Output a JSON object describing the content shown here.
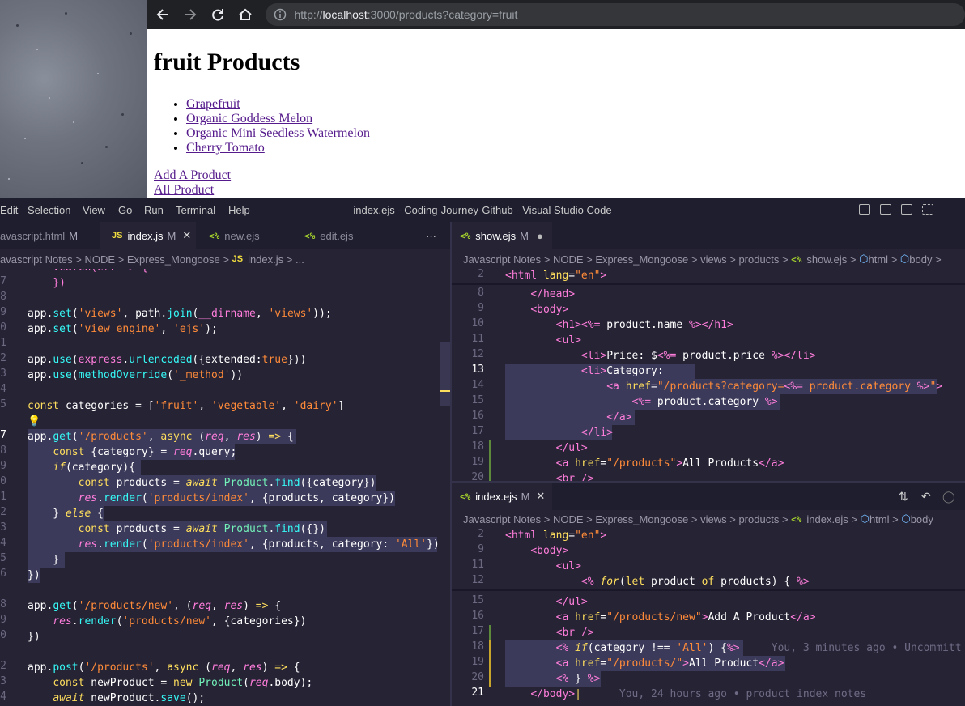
{
  "browser": {
    "url_scheme": "http://",
    "url_host": "localhost",
    "url_rest": ":3000/products?category=fruit",
    "heading": "fruit Products",
    "products": [
      "Grapefruit",
      "Organic Goddess Melon",
      "Organic Mini Seedless Watermelon",
      "Cherry Tomato"
    ],
    "add_link": "Add A Product",
    "all_link": "All Product"
  },
  "vscode": {
    "menu": [
      "Edit",
      "Selection",
      "View",
      "Go",
      "Run",
      "Terminal",
      "Help"
    ],
    "window_title": "index.ejs - Coding-Journey-Github - Visual Studio Code",
    "left_tabs": [
      {
        "label": "avascript.html",
        "badge": "M"
      },
      {
        "label": "index.js",
        "badge": "M",
        "icon": "JS"
      },
      {
        "label": "new.ejs",
        "icon": "<%"
      },
      {
        "label": "edit.ejs",
        "icon": "<%"
      }
    ],
    "left_breadcrumb": [
      "avascript Notes",
      ">",
      "NODE",
      ">",
      "Express_Mongoose",
      ">",
      "JS",
      "index.js",
      ">",
      "..."
    ],
    "right_top_tab": {
      "label": "show.ejs",
      "badge": "M",
      "icon": "<%"
    },
    "right_top_breadcrumb": [
      "Javascript Notes",
      ">",
      "NODE",
      ">",
      "Express_Mongoose",
      ">",
      "views",
      ">",
      "products",
      ">",
      "<%",
      "show.ejs",
      ">",
      "html",
      ">",
      "body",
      ">"
    ],
    "right_bottom_tab": {
      "label": "index.ejs",
      "badge": "M",
      "icon": "<%"
    },
    "right_bottom_breadcrumb": [
      "Javascript Notes",
      ">",
      "NODE",
      ">",
      "Express_Mongoose",
      ">",
      "views",
      ">",
      "products",
      ">",
      "<%",
      "index.ejs",
      ">",
      "html",
      ">",
      "body"
    ],
    "blame_line18": "You, 3 minutes ago • Uncommitt",
    "blame_line21": "You, 24 hours ago • product index notes",
    "left_line_numbers": [
      "7",
      "8",
      "9",
      "0",
      "1",
      "2",
      "3",
      "4",
      "5",
      "6",
      "7",
      "8",
      "9",
      "0",
      "1",
      "2",
      "3",
      "4",
      "5",
      "6",
      "7",
      "8",
      "9",
      "0",
      "1",
      "2",
      "3",
      "4",
      "5",
      "6"
    ],
    "right_top_line_numbers": [
      "2",
      "8",
      "9",
      "10",
      "11",
      "12",
      "13",
      "14",
      "15",
      "16",
      "17",
      "18",
      "19",
      "20"
    ],
    "right_bottom_line_numbers": [
      "2",
      "9",
      "11",
      "12",
      "15",
      "16",
      "17",
      "18",
      "19",
      "20",
      "21"
    ]
  },
  "colors": {
    "accent_keyword": "#fede5d",
    "string": "#ff8b39",
    "function": "#36f9f6",
    "tag": "#72f1b8",
    "variable": "#ff7edb",
    "editor_bg": "#262335"
  }
}
